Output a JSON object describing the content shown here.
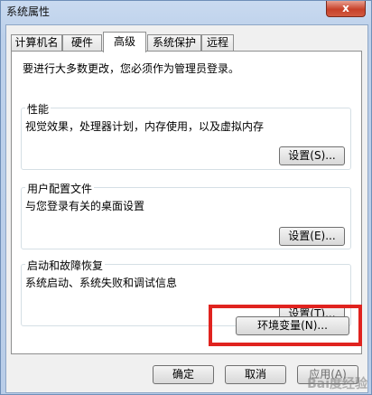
{
  "window": {
    "title": "系统属性",
    "close_label": "x"
  },
  "tabs": [
    {
      "label": "计算机名"
    },
    {
      "label": "硬件"
    },
    {
      "label": "高级"
    },
    {
      "label": "系统保护"
    },
    {
      "label": "远程"
    }
  ],
  "advanced": {
    "admin_note": "要进行大多数更改，您必须作为管理员登录。",
    "performance": {
      "title": "性能",
      "description": "视觉效果，处理器计划，内存使用，以及虚拟内存",
      "button": "设置(S)..."
    },
    "user_profiles": {
      "title": "用户配置文件",
      "description": "与您登录有关的桌面设置",
      "button": "设置(E)..."
    },
    "startup_recovery": {
      "title": "启动和故障恢复",
      "description": "系统启动、系统失败和调试信息",
      "button": "设置(T)..."
    },
    "env_button": "环境变量(N)..."
  },
  "footer": {
    "ok": "确定",
    "cancel": "取消",
    "apply": "应用(A)"
  },
  "watermark": "Bai度经验"
}
